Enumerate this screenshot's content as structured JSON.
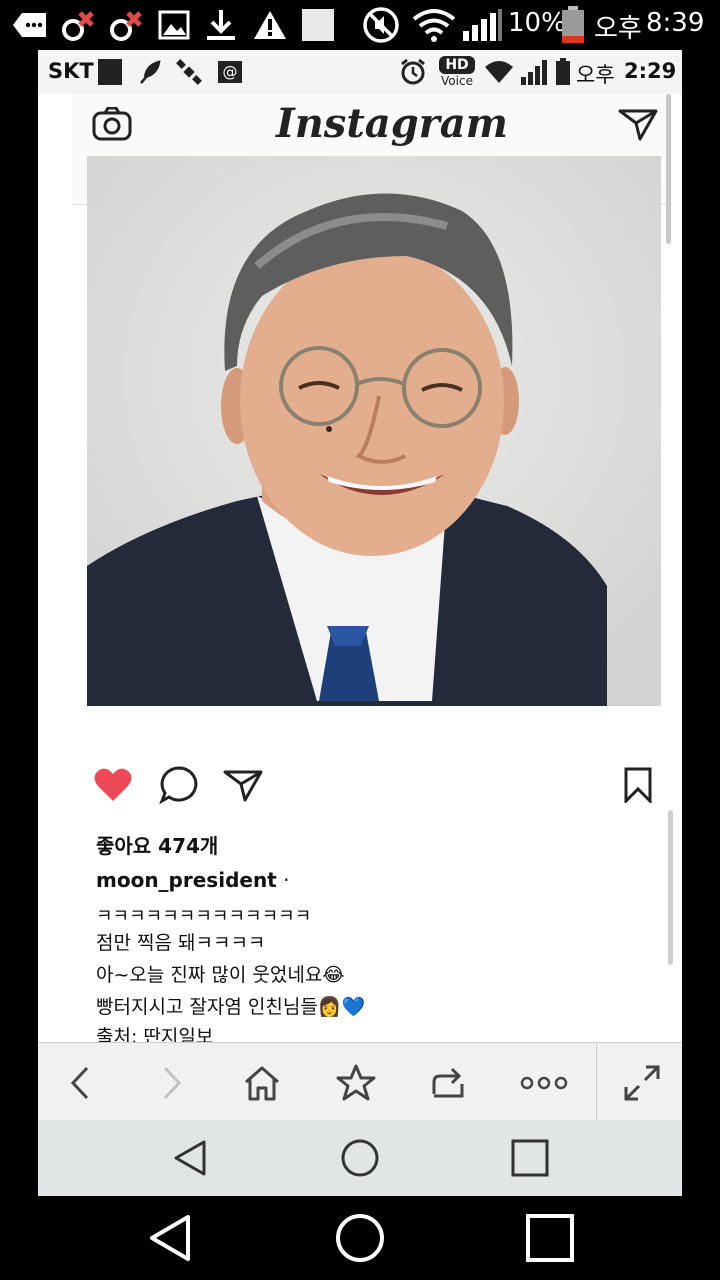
{
  "outer_status": {
    "battery_percent": "10%",
    "ampm": "오후",
    "time": "8:39",
    "left_icons": [
      "message-icon",
      "missed-call-icon",
      "missed-call-icon",
      "gallery-icon",
      "download-icon",
      "warning-icon",
      "placeholder-icon"
    ],
    "right_icons": [
      "mute-icon",
      "wifi-icon",
      "signal-icon",
      "battery-icon"
    ]
  },
  "inner_status": {
    "carrier": "SKT",
    "hd": "HD",
    "voice": "Voice",
    "ampm": "오후",
    "time": "2:29"
  },
  "instagram": {
    "logo": "Instagram",
    "likes": "좋아요 474개",
    "username": "moon_president",
    "username_suffix": " ·",
    "caption_lines": [
      "ㅋㅋㅋㅋㅋㅋㅋㅋㅋㅋㅋㅋㅋ",
      "점만 찍음 돼ㅋㅋㅋㅋ",
      "아~오늘 진짜 많이 웃었네요😂",
      "빵터지시고 잘자염 인친님들👩💙",
      "출처: 딴지일보"
    ],
    "like_color": "#ed4956"
  },
  "browser_toolbar": {
    "icons": [
      "back-icon",
      "forward-icon",
      "home-icon",
      "bookmark-star-icon",
      "share-icon",
      "more-icon",
      "fullscreen-icon"
    ]
  },
  "navigation": {
    "icons": [
      "nav-back-icon",
      "nav-home-icon",
      "nav-recents-icon"
    ]
  }
}
